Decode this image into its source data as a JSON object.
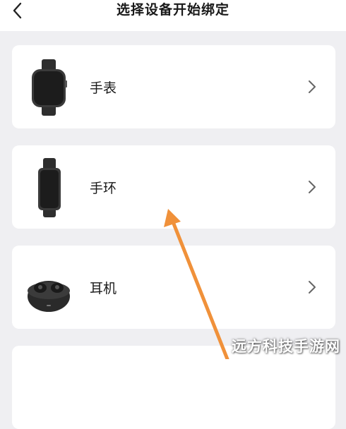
{
  "header": {
    "title": "选择设备开始绑定",
    "back_icon": "chevron-left-icon"
  },
  "devices": [
    {
      "label": "手表",
      "icon": "smartwatch-icon"
    },
    {
      "label": "手环",
      "icon": "fitness-band-icon"
    },
    {
      "label": "耳机",
      "icon": "earbuds-case-icon"
    }
  ],
  "chevron_icon": "chevron-right-icon",
  "annotation_arrow_color": "#f0913a",
  "watermark": "远方科技手游网"
}
